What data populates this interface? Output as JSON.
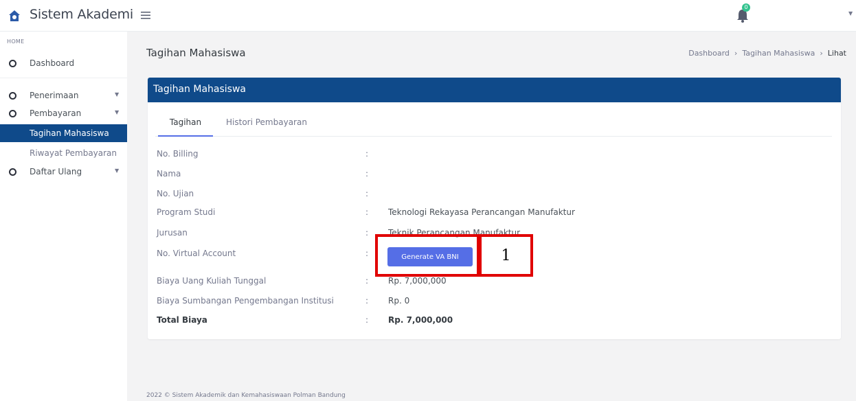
{
  "topbar": {
    "app_title": "Sistem Akademik",
    "logo_icon": "home-icon",
    "menu_icon": "hamburger-icon",
    "notifications_icon": "bell-icon",
    "notification_count": "0",
    "user_menu_icon": "caret-down-icon"
  },
  "sidebar": {
    "menu_title": "HOME",
    "items": [
      {
        "label": "Dashboard",
        "has_submenu": false
      },
      {
        "label": "Penerimaan",
        "has_submenu": true
      },
      {
        "label": "Pembayaran",
        "has_submenu": true,
        "expanded": true,
        "subitems": [
          {
            "label": "Tagihan Mahasiswa",
            "active": true
          },
          {
            "label": "Riwayat Pembayaran",
            "active": false
          }
        ]
      },
      {
        "label": "Daftar Ulang",
        "has_submenu": true
      }
    ]
  },
  "page": {
    "title": "Tagihan Mahasiswa",
    "breadcrumb": [
      "Dashboard",
      "Tagihan Mahasiswa",
      "Lihat"
    ]
  },
  "card": {
    "header": "Tagihan Mahasiswa",
    "tabs": [
      {
        "label": "Tagihan",
        "active": true
      },
      {
        "label": "Histori Pembayaran",
        "active": false
      }
    ],
    "colon": ":",
    "fields": [
      {
        "label": "No. Billing",
        "value": ""
      },
      {
        "label": "Nama",
        "value": ""
      },
      {
        "label": "No. Ujian",
        "value": ""
      },
      {
        "label": "Program Studi",
        "value": "Teknologi Rekayasa Perancangan Manufaktur"
      },
      {
        "label": "Jurusan",
        "value": "Teknik Perancangan Manufaktur"
      },
      {
        "label": "No. Virtual Account",
        "value": ""
      },
      {
        "label": "Biaya Uang Kuliah Tunggal",
        "value": "Rp. 7,000,000"
      },
      {
        "label": "Biaya Sumbangan Pengembangan Institusi",
        "value": "Rp. 0"
      },
      {
        "label": "Total Biaya",
        "value": "Rp. 7,000,000"
      }
    ],
    "generate_button": "Generate VA BNI"
  },
  "annotation": {
    "number": "1",
    "color": "#e00000"
  },
  "footer": "2022 © Sistem Akademik dan Kemahasiswaan Polman Bandung",
  "colors": {
    "primary": "#0f4a8a",
    "button": "#556ee6",
    "badge": "#34c38f"
  }
}
